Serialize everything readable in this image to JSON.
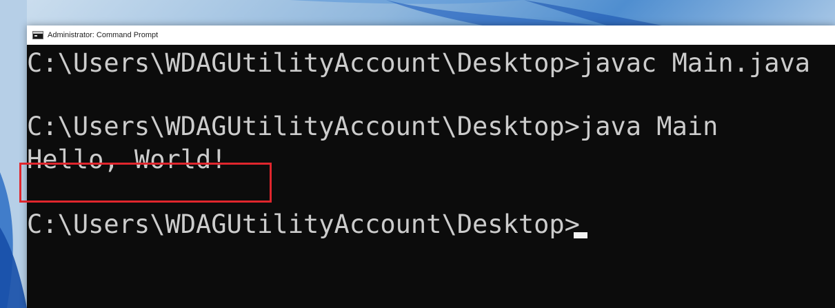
{
  "window": {
    "title": "Administrator: Command Prompt",
    "icon": "command-prompt-icon"
  },
  "terminal": {
    "lines": [
      "C:\\Users\\WDAGUtilityAccount\\Desktop>javac Main.java",
      "",
      "C:\\Users\\WDAGUtilityAccount\\Desktop>java Main",
      "Hello, World!",
      "",
      "C:\\Users\\WDAGUtilityAccount\\Desktop>"
    ],
    "highlighted_line": "Hello, World!",
    "colors": {
      "background": "#0c0c0c",
      "text": "#cccccc",
      "highlight_border": "#e0262d"
    }
  }
}
